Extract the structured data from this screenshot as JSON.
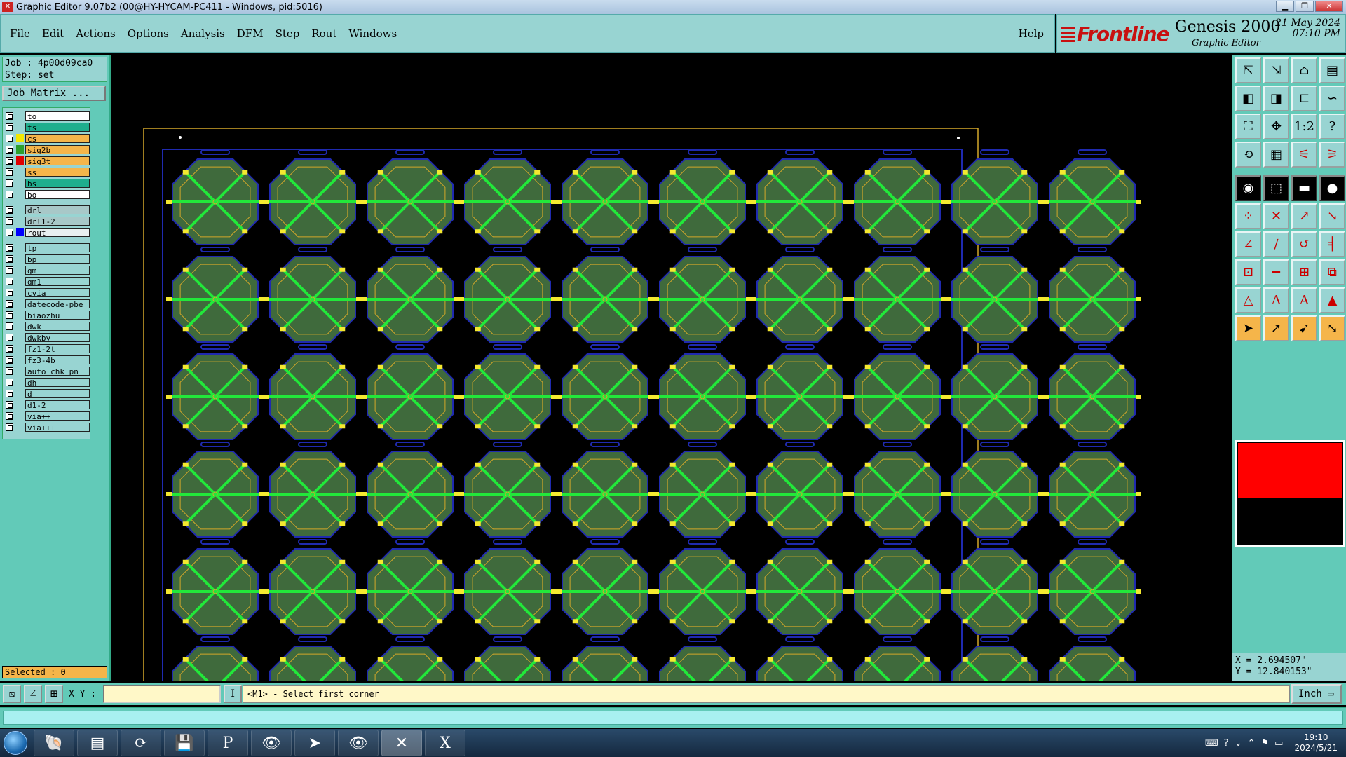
{
  "title_bar": {
    "text": "Graphic Editor 9.07b2 (00@HY-HYCAM-PC411 - Windows, pid:5016)",
    "app_icon": "graphic-editor-icon",
    "controls": [
      "minimize",
      "maximize",
      "close"
    ]
  },
  "menu": {
    "items": [
      "File",
      "Edit",
      "Actions",
      "Options",
      "Analysis",
      "DFM",
      "Step",
      "Rout",
      "Windows"
    ],
    "help": "Help"
  },
  "brand": {
    "logo": "Frontline",
    "product": "Genesis 2000",
    "subtitle": "Graphic Editor",
    "date": "21 May 2024",
    "time": "07:10 PM"
  },
  "job": {
    "job_line": "Job : 4p00d09ca0",
    "step_line": "Step: set",
    "matrix_button": "Job Matrix ..."
  },
  "layers": [
    {
      "name": "to",
      "bg": "#ffffff",
      "swatch": ""
    },
    {
      "name": "ts",
      "bg": "#1fae8e",
      "swatch": ""
    },
    {
      "name": "cs",
      "bg": "#f5b54a",
      "swatch": "#f4e800"
    },
    {
      "name": "sig2b",
      "bg": "#f5b54a",
      "swatch": "#2ca02c"
    },
    {
      "name": "sig3t",
      "bg": "#f5b54a",
      "swatch": "#e00000"
    },
    {
      "name": "ss",
      "bg": "#f5b54a",
      "swatch": ""
    },
    {
      "name": "bs",
      "bg": "#1fae8e",
      "swatch": ""
    },
    {
      "name": "bo",
      "bg": "#ffffff",
      "swatch": ""
    },
    {
      "name": "drl",
      "bg": "#a8c8c8",
      "swatch": ""
    },
    {
      "name": "drl1-2",
      "bg": "#a8c8c8",
      "swatch": ""
    },
    {
      "name": "rout",
      "bg": "#e8f0f0",
      "swatch": "#0000ff"
    },
    {
      "name": "tp",
      "bg": "#98d4d2",
      "swatch": ""
    },
    {
      "name": "bp",
      "bg": "#98d4d2",
      "swatch": ""
    },
    {
      "name": "gm",
      "bg": "#98d4d2",
      "swatch": ""
    },
    {
      "name": "gm1",
      "bg": "#98d4d2",
      "swatch": ""
    },
    {
      "name": "cvia",
      "bg": "#98d4d2",
      "swatch": ""
    },
    {
      "name": "datecode-pbe",
      "bg": "#98d4d2",
      "swatch": ""
    },
    {
      "name": "biaozhu",
      "bg": "#98d4d2",
      "swatch": ""
    },
    {
      "name": "dwk",
      "bg": "#98d4d2",
      "swatch": ""
    },
    {
      "name": "dwkby",
      "bg": "#98d4d2",
      "swatch": ""
    },
    {
      "name": "fz1-2t",
      "bg": "#98d4d2",
      "swatch": ""
    },
    {
      "name": "fz3-4b",
      "bg": "#98d4d2",
      "swatch": ""
    },
    {
      "name": "auto_chk_pn_",
      "bg": "#98d4d2",
      "swatch": ""
    },
    {
      "name": "dh",
      "bg": "#98d4d2",
      "swatch": ""
    },
    {
      "name": "d",
      "bg": "#98d4d2",
      "swatch": ""
    },
    {
      "name": "d1-2",
      "bg": "#98d4d2",
      "swatch": ""
    },
    {
      "name": "via++",
      "bg": "#98d4d2",
      "swatch": ""
    },
    {
      "name": "via+++",
      "bg": "#98d4d2",
      "swatch": ""
    }
  ],
  "selected": "Selected : 0",
  "coordinates": {
    "x": "X = 2.694507\"",
    "y": "Y = 12.840153\""
  },
  "bottom": {
    "xy_label": "X Y :",
    "xy_value": "",
    "message": "<M1> - Select first corner",
    "unit": "Inch"
  },
  "toolbar_icons": [
    "zoom-home-icon",
    "zoom-in-icon",
    "home-icon",
    "layout-icon",
    "pan-left-icon",
    "pan-right-icon",
    "mirror-icon",
    "flip-icon",
    "fit-icon",
    "center-icon",
    "one-to-one-icon",
    "help-icon",
    "redraw-icon",
    "grid-icon",
    "measure-icon",
    "snap-icon",
    "add-pad-icon",
    "add-shape-icon",
    "ruler-icon",
    "circle-icon",
    "connect-icon",
    "delete-icon",
    "move-icon",
    "copy-icon",
    "line-icon",
    "slash-icon",
    "arc-icon",
    "split-icon",
    "resize-icon",
    "minus-icon",
    "align-icon",
    "group-icon",
    "triangle-icon",
    "triangle-a-icon",
    "triangle-b-icon",
    "triangle-c-icon",
    "pointer-icon",
    "select-icon",
    "snap-pointer-icon",
    "step-pointer-icon"
  ],
  "canvas": {
    "panel_rows": 6,
    "panel_cols": 10,
    "board_fill": "#3f6a3c",
    "trace_color": "#22e83a",
    "outline_color": "#d4a82a",
    "rout_color": "#1f2ab0"
  },
  "taskbar": {
    "apps": [
      "shell-app-icon",
      "notepad-app-icon",
      "acrobat-app-icon",
      "save-app-icon",
      "publisher-app-icon",
      "eye-app-icon",
      "arrow-app-icon",
      "eye2-app-icon",
      "genesis-app-icon",
      "excel-app-icon"
    ],
    "clock_time": "19:10",
    "clock_date": "2024/5/21"
  }
}
